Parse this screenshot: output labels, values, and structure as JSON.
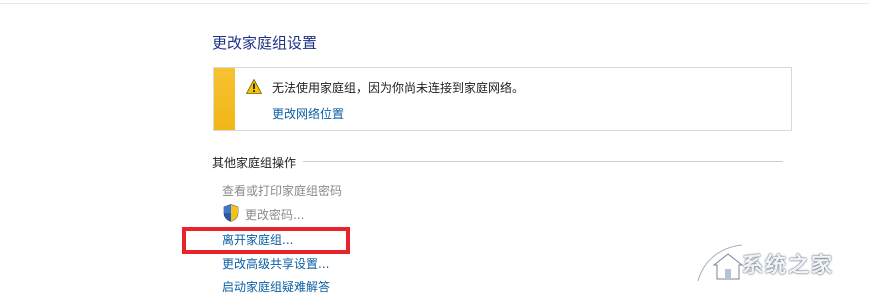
{
  "page": {
    "title": "更改家庭组设置"
  },
  "notice": {
    "message": "无法使用家庭组，因为你尚未连接到家庭网络。",
    "link": "更改网络位置",
    "strip_color": "#f3bb22",
    "icon": "warning-icon"
  },
  "section": {
    "title": "其他家庭组操作",
    "actions": [
      {
        "label": "查看或打印家庭组密码",
        "state": "disabled"
      },
      {
        "label": "更改密码...",
        "state": "disabled",
        "icon": "uac-shield-icon"
      },
      {
        "label": "离开家庭组...",
        "state": "link",
        "highlighted": true
      },
      {
        "label": "更改高级共享设置...",
        "state": "link"
      },
      {
        "label": "启动家庭组疑难解答",
        "state": "link"
      }
    ]
  },
  "annotation": {
    "highlight_color": "#e8232a"
  },
  "watermark": {
    "text": "系统之家",
    "icon": "house-logo-icon"
  }
}
